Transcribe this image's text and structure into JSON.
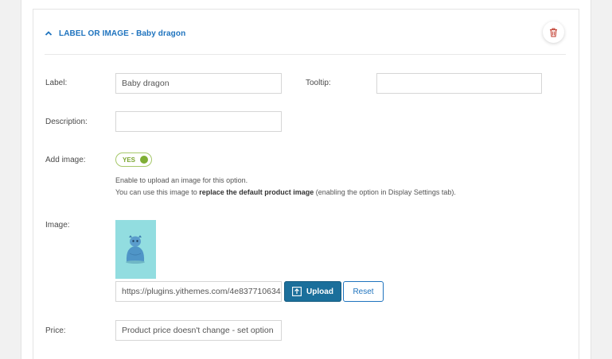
{
  "header": {
    "title": "LABEL OR IMAGE - Baby dragon"
  },
  "form": {
    "label": {
      "label": "Label:",
      "value": "Baby dragon"
    },
    "tooltip": {
      "label": "Tooltip:",
      "value": ""
    },
    "description": {
      "label": "Description:",
      "value": ""
    },
    "add_image": {
      "label": "Add image:",
      "toggle_text": "YES",
      "help_line1": "Enable to upload an image for this option.",
      "help_line2_prefix": "You can use this image to ",
      "help_line2_bold": "replace the default product image",
      "help_line2_suffix": " (enabling the option in Display Settings tab)."
    },
    "image": {
      "label": "Image:",
      "url": "https://plugins.yithemes.com/4e837710634",
      "upload_label": "Upload",
      "reset_label": "Reset"
    },
    "price": {
      "label": "Price:",
      "value": "Product price doesn't change - set option"
    }
  },
  "colors": {
    "accent": "#1e73be",
    "upload_bg": "#1b6f9b",
    "toggle_green": "#7fae35",
    "trash_red": "#c0392b"
  },
  "icons": {
    "collapse": "chevron-up-icon",
    "delete": "trash-icon",
    "upload": "upload-icon"
  }
}
